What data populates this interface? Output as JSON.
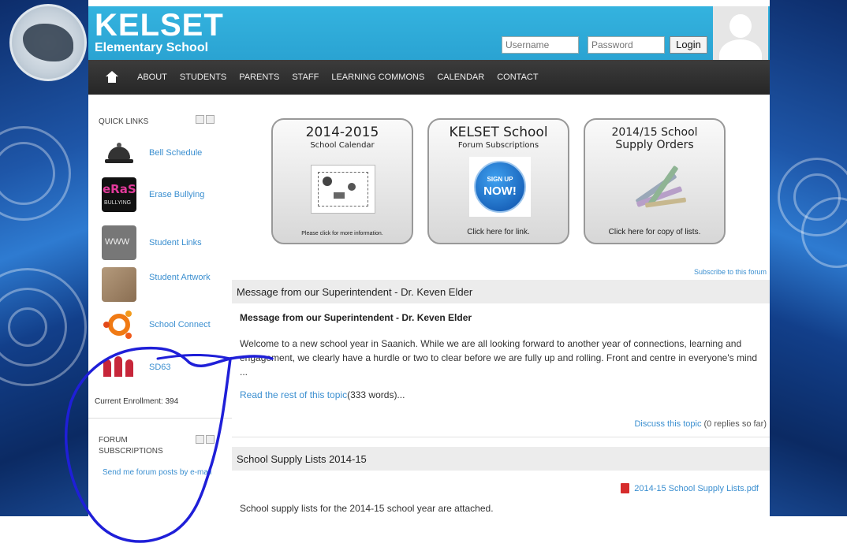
{
  "header": {
    "school_name": "KELSET",
    "school_subtitle": "Elementary School",
    "username_placeholder": "Username",
    "password_placeholder": "Password",
    "login_label": "Login"
  },
  "nav": {
    "items": [
      "ABOUT",
      "STUDENTS",
      "PARENTS",
      "STAFF",
      "LEARNING COMMONS",
      "CALENDAR",
      "CONTACT"
    ]
  },
  "sidebar": {
    "quick_links_title": "QUICK LINKS",
    "items": [
      {
        "label": "Bell Schedule",
        "icon": "bell-icon"
      },
      {
        "label": "Erase Bullying",
        "icon": "erase-bullying-icon",
        "icon_text": "eRaSe",
        "icon_sub": "BULLYING"
      },
      {
        "label": "Student Links",
        "icon": "www-icon",
        "icon_text": "WWW"
      },
      {
        "label": "Student Artwork",
        "icon": "artwork-icon"
      },
      {
        "label": "School Connect",
        "icon": "school-connect-icon"
      },
      {
        "label": "SD63",
        "icon": "sd63-icon"
      }
    ],
    "enrollment": "Current Enrollment: 394",
    "forum_title": "FORUM SUBSCRIPTIONS",
    "forum_link": "Send me forum posts by e-mail"
  },
  "promos": [
    {
      "line1": "2014-2015",
      "line2": "School Calendar",
      "footer": "Please click for more information."
    },
    {
      "line1": "KELSET School",
      "line2": "Forum Subscriptions",
      "badge_top": "SIGN UP",
      "badge_main": "NOW!",
      "footer": "Click here for link."
    },
    {
      "line1": "2014/15 School",
      "line2": "Supply Orders",
      "footer": "Click here for copy of lists."
    }
  ],
  "main": {
    "subscribe_link": "Subscribe to this forum",
    "message_heading": "Message from our Superintendent - Dr. Keven Elder",
    "message_title": "Message from our Superintendent - Dr. Keven Elder",
    "message_body": "Welcome to a new school year in Saanich. While we are all looking forward to another year of connections, learning and engagement, we clearly have a hurdle or two to clear before we are fully up and rolling. Front and centre in everyone's mind ...",
    "read_more_link": "Read the rest of this topic",
    "read_more_count": "(333 words)...",
    "discuss_link": "Discuss this topic",
    "discuss_count": "(0 replies so far)",
    "supply_heading": "School Supply Lists 2014-15",
    "pdf_link": "2014-15 School Supply Lists.pdf",
    "supply_text": "School supply lists for the 2014-15 school year are attached."
  },
  "colors": {
    "header": "#2aa3d2",
    "nav": "#2b2b2b",
    "link": "#3b8fd0",
    "annotation": "#1f1fd8"
  }
}
